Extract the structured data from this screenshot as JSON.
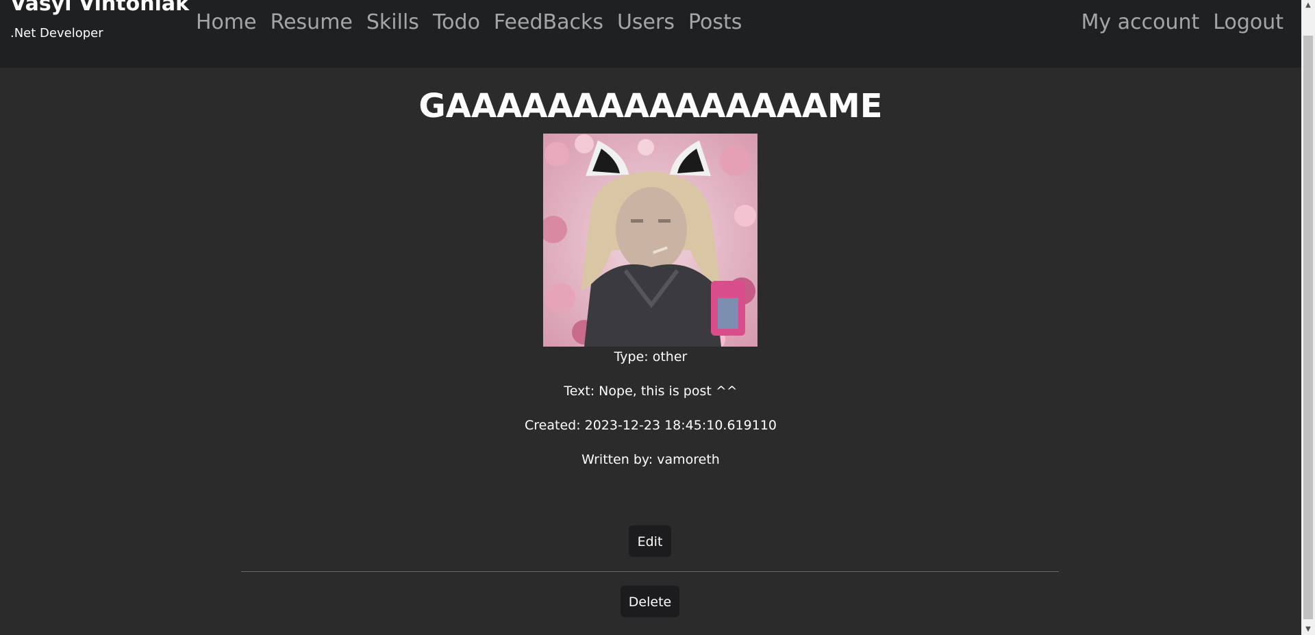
{
  "nav": {
    "brand_name": "Vasyl Vintoniak",
    "brand_subtitle": ".Net Developer",
    "links": [
      "Home",
      "Resume",
      "Skills",
      "Todo",
      "FeedBacks",
      "Users",
      "Posts"
    ],
    "right_links": [
      "My account",
      "Logout"
    ]
  },
  "post": {
    "title": "GAAAAAAAAAAAAAAAME",
    "type_line": "Type: other",
    "text_line": "Text: Nope, this is post ^^",
    "created_line": "Created: 2023-12-23 18:45:10.619110",
    "author_line": "Written by: vamoreth"
  },
  "actions": {
    "edit_label": "Edit",
    "delete_label": "Delete"
  },
  "colors": {
    "page_bg": "#2b2b2b",
    "navbar_bg": "#1f2022",
    "button_bg": "#1c1c1e"
  }
}
